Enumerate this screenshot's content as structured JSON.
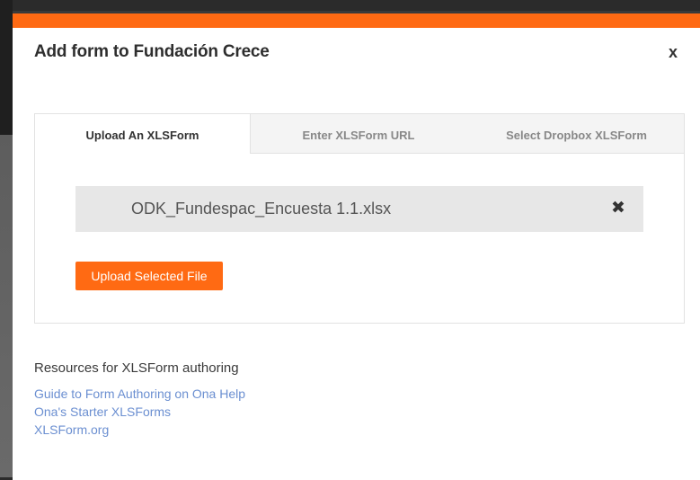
{
  "modal": {
    "title": "Add form to Fundación Crece",
    "close_label": "x"
  },
  "tabs": [
    {
      "label": "Upload An XLSForm",
      "active": true
    },
    {
      "label": "Enter XLSForm URL",
      "active": false
    },
    {
      "label": "Select Dropbox XLSForm",
      "active": false
    }
  ],
  "upload": {
    "selected_file": "ODK_Fundespac_Encuesta 1.1.xlsx",
    "remove_icon": "close-x-icon",
    "button_label": "Upload Selected File"
  },
  "resources": {
    "heading": "Resources for XLSForm authoring",
    "links": [
      {
        "label": "Guide to Form Authoring on Ona Help"
      },
      {
        "label": "Ona's Starter XLSForms"
      },
      {
        "label": "XLSForm.org"
      }
    ]
  },
  "colors": {
    "accent": "#ff6a13",
    "link": "#6b8fd1"
  }
}
